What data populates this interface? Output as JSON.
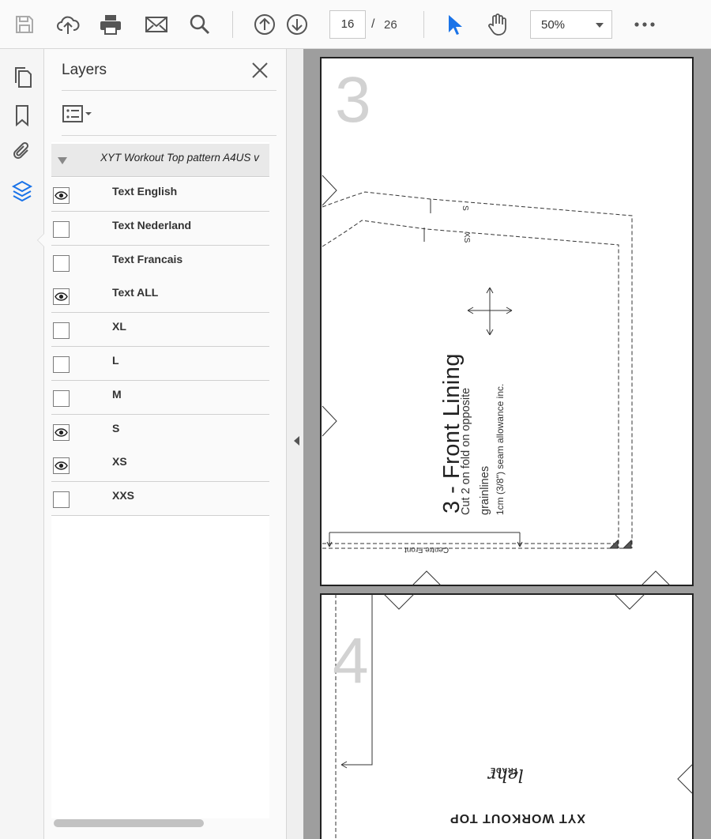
{
  "toolbar": {
    "current_page": "16",
    "page_separator": "/",
    "total_pages": "26",
    "zoom": "50%",
    "icons": [
      "save-icon",
      "cloud-upload-icon",
      "print-icon",
      "mail-icon",
      "search-icon",
      "page-up-icon",
      "page-down-icon",
      "select-arrow-icon",
      "hand-icon",
      "more-icon"
    ],
    "accent_color": "#1a73e8"
  },
  "rail": {
    "icons": [
      "pages-icon",
      "bookmark-icon",
      "attachment-icon",
      "layers-icon"
    ]
  },
  "layers_panel": {
    "title": "Layers",
    "root_layer": "XYT Workout Top pattern A4US v",
    "layers": [
      {
        "label": "Text English",
        "visible": true
      },
      {
        "label": "Text Nederland",
        "visible": false
      },
      {
        "label": "Text Francais",
        "visible": false
      },
      {
        "label": "Text ALL",
        "visible": true
      },
      {
        "label": "XL",
        "visible": false
      },
      {
        "label": "L",
        "visible": false
      },
      {
        "label": "M",
        "visible": false
      },
      {
        "label": "S",
        "visible": true
      },
      {
        "label": "XS",
        "visible": true
      },
      {
        "label": "XXS",
        "visible": false
      }
    ]
  },
  "document": {
    "page_a_number": "3",
    "page_b_number": "4",
    "piece_title": "3 - Front Lining",
    "piece_line1": "Cut 2 on fold on opposite",
    "piece_line2": "grainlines",
    "piece_line3": "1cm (3/8\") seam allowance inc.",
    "centre_front": "Centre Front",
    "size_s": "S",
    "size_xs": "XS",
    "brand_title": "XYT WORKOUT TOP",
    "logo_script": "lehr",
    "logo_trade": "TRADE"
  }
}
